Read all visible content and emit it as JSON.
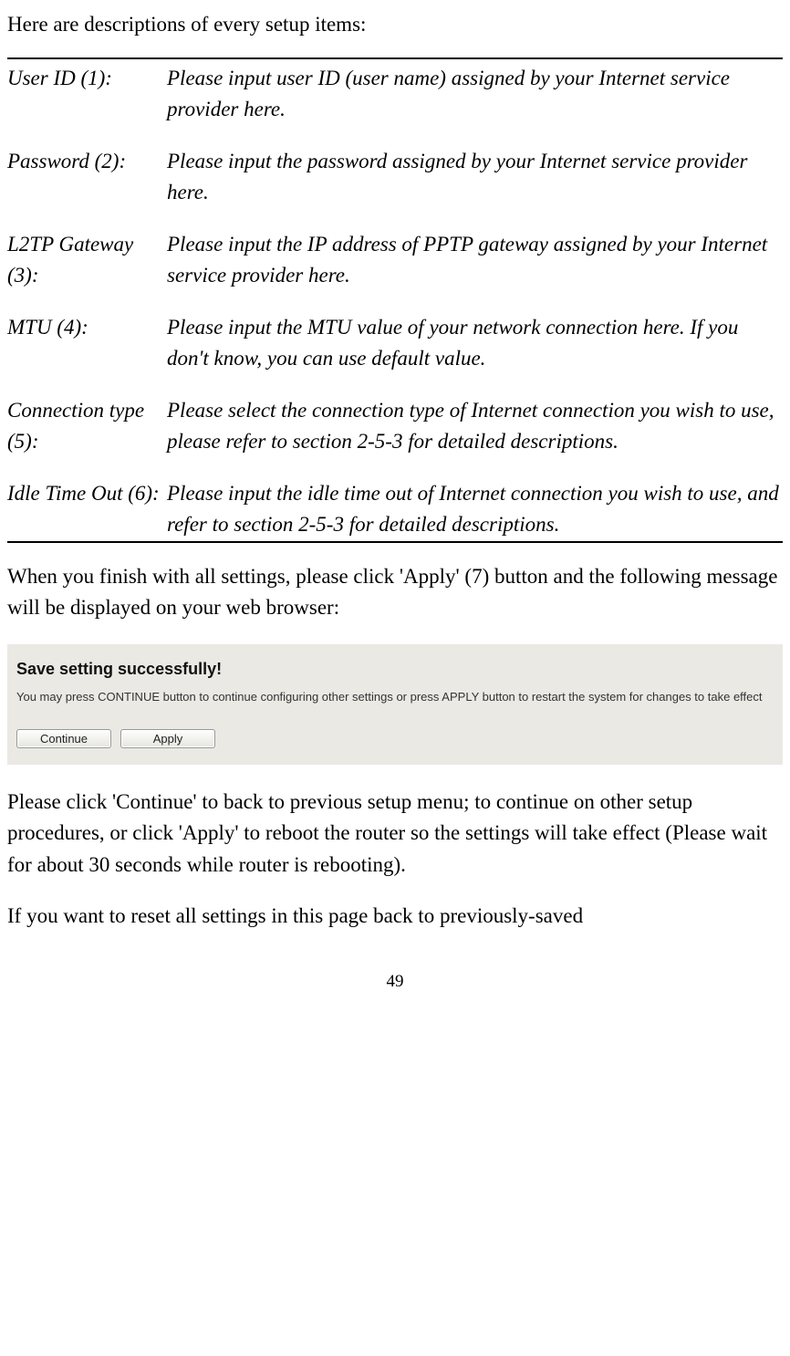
{
  "intro": "Here are descriptions of every setup items:",
  "items": [
    {
      "label": "User ID (1):",
      "desc": "Please input user ID (user name) assigned by your Internet service provider here."
    },
    {
      "label": "Password (2):",
      "desc": "Please input the password assigned by your Internet service provider here."
    },
    {
      "label": "L2TP Gateway (3):",
      "desc": "Please input the IP address of PPTP gateway assigned by your Internet service provider here."
    },
    {
      "label": "MTU (4):",
      "desc": "Please input the MTU value of your network connection here. If you don't know, you can use default value."
    },
    {
      "label": "Connection type (5):",
      "desc": "Please select the connection type of Internet connection you wish to use, please refer to section 2-5-3 for detailed descriptions."
    },
    {
      "label": "Idle Time Out (6):",
      "desc": "Please input the idle time out of Internet connection you wish to use, and refer to section 2-5-3 for detailed descriptions."
    }
  ],
  "after_table": "When you finish with all settings, please click 'Apply' (7) button and the following message will be displayed on your web browser:",
  "ui": {
    "title": "Save setting successfully!",
    "message": "You may press CONTINUE button to continue configuring other settings or press APPLY button to restart the system for changes to take effect",
    "continue_label": "Continue",
    "apply_label": "Apply"
  },
  "para2": "Please click 'Continue' to back to previous setup menu; to continue on other setup procedures, or click 'Apply' to reboot the router so the settings will take effect (Please wait for about 30 seconds while router is rebooting).",
  "para3": "If you want to reset all settings in this page back to previously-saved",
  "page_number": "49"
}
